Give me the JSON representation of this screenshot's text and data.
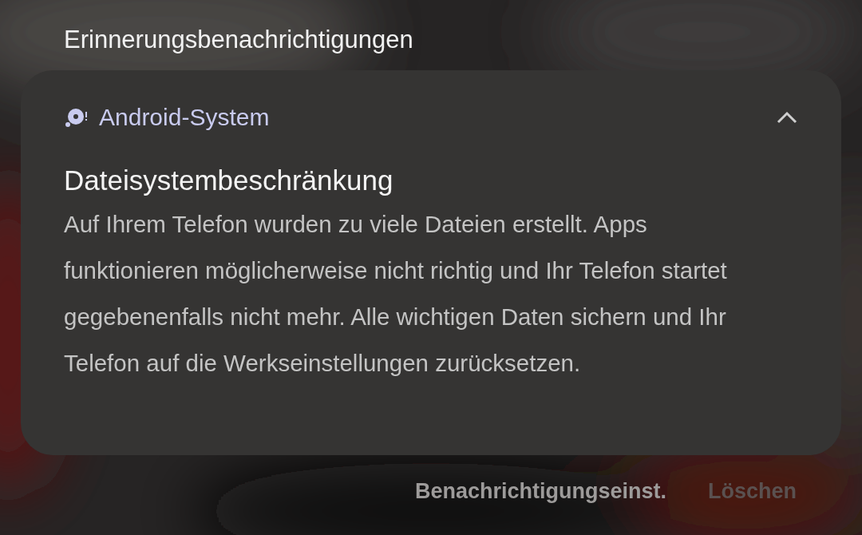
{
  "section_title": "Erinnerungsbenachrichtigungen",
  "notification": {
    "app_name": "Android-System",
    "expanded": true,
    "title": "Dateisystembeschränkung",
    "body": "Auf Ihrem Telefon wurden zu viele Dateien erstellt. Apps funktionieren möglicherweise nicht richtig und Ihr Telefon startet gegebenenfalls nicht mehr. Alle wichtigen Daten sichern und Ihr Telefon auf die Werkseinstellungen zurücksetzen."
  },
  "actions": [
    {
      "label": "Benachrichtigungseinst.",
      "disabled": false
    },
    {
      "label": "Löschen",
      "disabled": true
    }
  ]
}
